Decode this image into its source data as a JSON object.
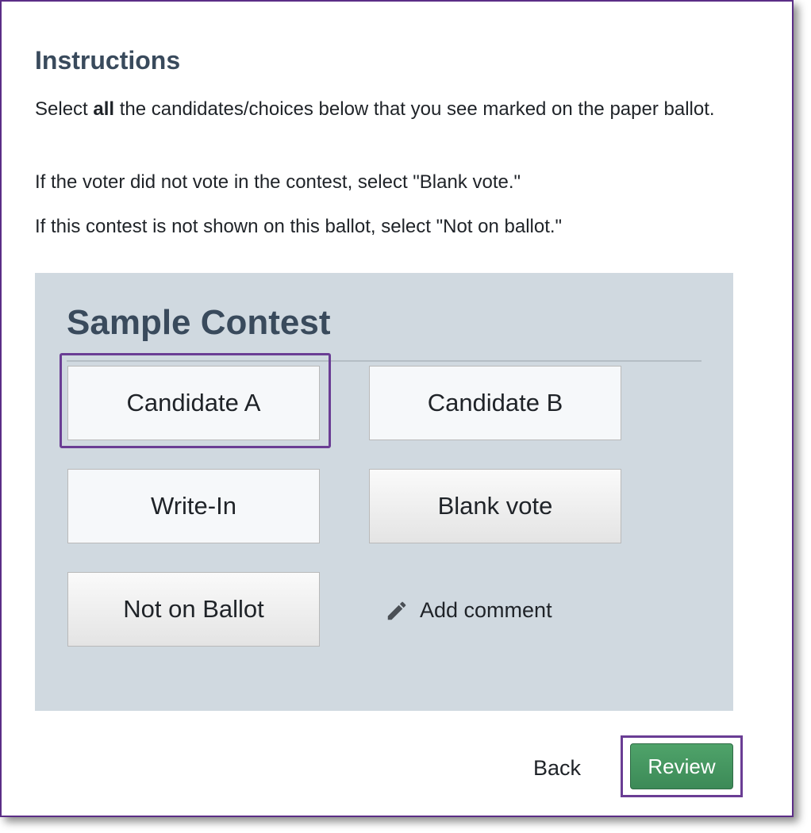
{
  "instructions": {
    "title": "Instructions",
    "p1_before": "Select ",
    "p1_bold": "all",
    "p1_after": " the candidates/choices below that you see marked on the paper ballot.",
    "p2": "If the voter did not vote in the contest, select \"Blank vote.\"",
    "p3": "If this contest is not shown on this ballot, select \"Not on ballot.\""
  },
  "contest": {
    "title": "Sample Contest",
    "choices": [
      {
        "label": "Candidate A"
      },
      {
        "label": "Candidate B"
      },
      {
        "label": "Write-In"
      },
      {
        "label": "Blank vote"
      },
      {
        "label": "Not on Ballot"
      }
    ],
    "add_comment": "Add comment",
    "add_comment_icon": "pencil-icon"
  },
  "footer": {
    "back_label": "Back",
    "review_label": "Review"
  },
  "colors": {
    "heading": "#394a5c",
    "panel_background": "#d0d9e0",
    "highlight": "#6a3d94",
    "review_button": "#3f9460"
  }
}
